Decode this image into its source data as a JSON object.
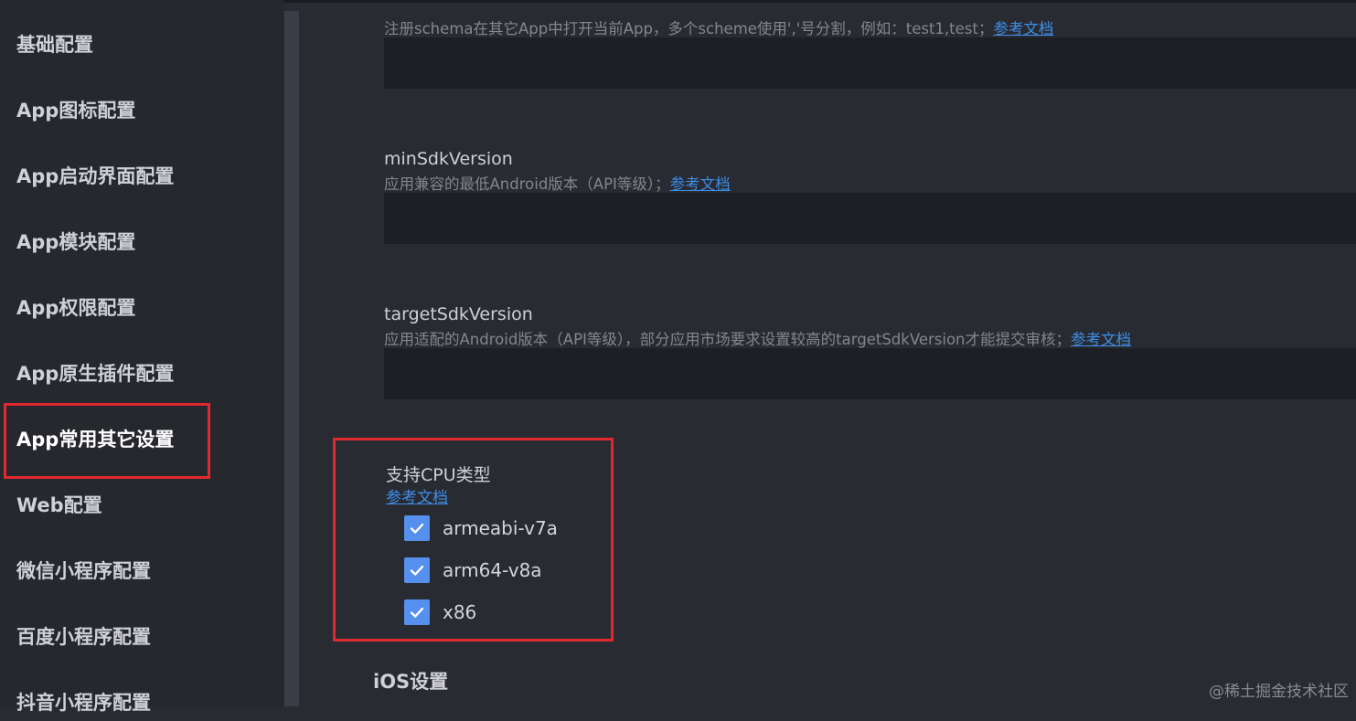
{
  "sidebar": {
    "items": [
      {
        "label": "基础配置"
      },
      {
        "label": "App图标配置"
      },
      {
        "label": "App启动界面配置"
      },
      {
        "label": "App模块配置"
      },
      {
        "label": "App权限配置"
      },
      {
        "label": "App原生插件配置"
      },
      {
        "label": "App常用其它设置"
      },
      {
        "label": "Web配置"
      },
      {
        "label": "微信小程序配置"
      },
      {
        "label": "百度小程序配置"
      },
      {
        "label": "抖音小程序配置"
      }
    ],
    "active_index": 6
  },
  "main": {
    "schemes": {
      "description": "注册schema在其它App中打开当前App，多个scheme使用','号分割，例如：test1,test；",
      "doc_link": "参考文档",
      "value": ""
    },
    "min_sdk": {
      "title": "minSdkVersion",
      "description": "应用兼容的最低Android版本（API等级）；",
      "doc_link": "参考文档",
      "value": ""
    },
    "target_sdk": {
      "title": "targetSdkVersion",
      "description": "应用适配的Android版本（API等级），部分应用市场要求设置较高的targetSdkVersion才能提交审核；",
      "doc_link": "参考文档",
      "value": ""
    },
    "cpu": {
      "title": "支持CPU类型",
      "doc_link": "参考文档",
      "options": [
        {
          "label": "armeabi-v7a",
          "checked": true
        },
        {
          "label": "arm64-v8a",
          "checked": true
        },
        {
          "label": "x86",
          "checked": true
        }
      ]
    },
    "ios_section_title": "iOS设置"
  },
  "watermark": "@稀土掘金技术社区",
  "colors": {
    "background": "#292b33",
    "sidebar": "#27282e",
    "input": "#1e1f24",
    "link": "#3d8ee6",
    "checkbox": "#5590ee",
    "highlight": "#e0282f"
  }
}
